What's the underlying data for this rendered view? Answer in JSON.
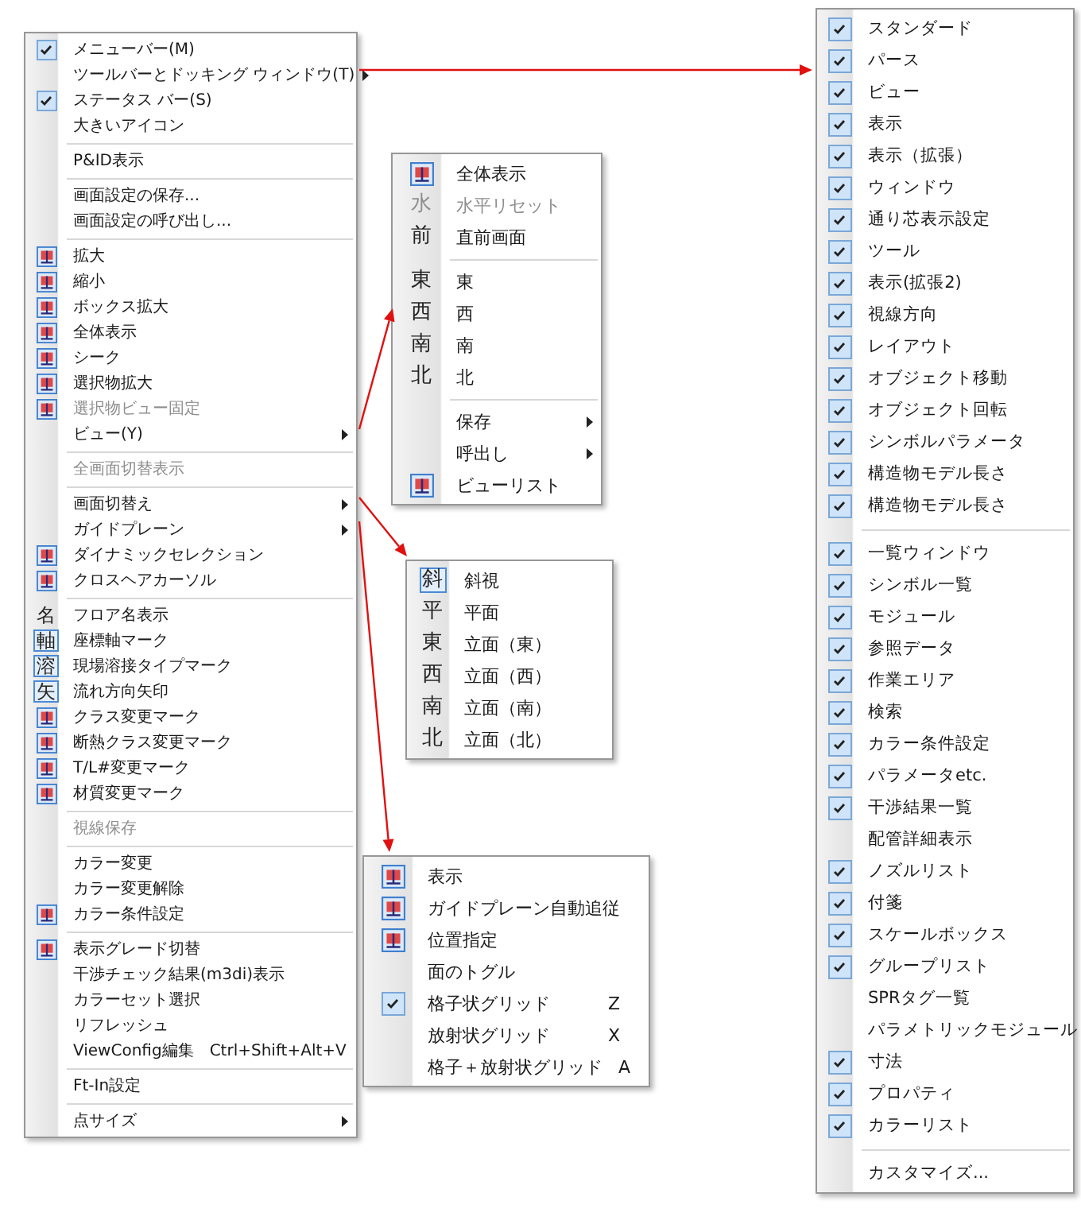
{
  "menus": [
    {
      "items": [
        {
          "kind": "item",
          "label": "メニューバー(M)",
          "checked": true,
          "disabled": false,
          "submenu": false
        },
        {
          "kind": "item",
          "label": "ツールバーとドッキング ウィンドウ(T)",
          "checked": false,
          "disabled": false,
          "submenu": true
        },
        {
          "kind": "item",
          "label": "ステータス バー(S)",
          "checked": true,
          "disabled": false,
          "submenu": false
        },
        {
          "kind": "item",
          "label": "大きいアイコン",
          "checked": false,
          "disabled": false,
          "submenu": false
        },
        {
          "kind": "separator"
        },
        {
          "kind": "item",
          "label": "P&ID表示",
          "checked": false,
          "disabled": false,
          "submenu": false
        },
        {
          "kind": "separator"
        },
        {
          "kind": "item",
          "label": "画面設定の保存...",
          "checked": false,
          "disabled": false,
          "submenu": false
        },
        {
          "kind": "item",
          "label": "画面設定の呼び出し...",
          "checked": false,
          "disabled": false,
          "submenu": false
        },
        {
          "kind": "separator"
        },
        {
          "kind": "item",
          "label": "拡大",
          "icon": true,
          "checked": false,
          "disabled": false,
          "submenu": false
        },
        {
          "kind": "item",
          "label": "縮小",
          "icon": true,
          "checked": false,
          "disabled": false,
          "submenu": false
        },
        {
          "kind": "item",
          "label": "ボックス拡大",
          "icon": true,
          "checked": false,
          "disabled": false,
          "submenu": false
        },
        {
          "kind": "item",
          "label": "全体表示",
          "icon": true,
          "checked": false,
          "disabled": false,
          "submenu": false
        },
        {
          "kind": "item",
          "label": "シーク",
          "icon": true,
          "checked": false,
          "disabled": false,
          "submenu": false
        },
        {
          "kind": "item",
          "label": "選択物拡大",
          "icon": true,
          "checked": false,
          "disabled": false,
          "submenu": false
        },
        {
          "kind": "item",
          "label": "選択物ビュー固定",
          "icon": true,
          "checked": false,
          "disabled": true,
          "submenu": false
        },
        {
          "kind": "item",
          "label": "ビュー(Y)",
          "checked": false,
          "disabled": false,
          "submenu": true
        },
        {
          "kind": "separator"
        },
        {
          "kind": "item",
          "label": "全画面切替表示",
          "checked": false,
          "disabled": true,
          "submenu": false
        },
        {
          "kind": "separator"
        },
        {
          "kind": "item",
          "label": "画面切替え",
          "checked": false,
          "disabled": false,
          "submenu": true
        },
        {
          "kind": "item",
          "label": "ガイドプレーン",
          "checked": false,
          "disabled": false,
          "submenu": true
        },
        {
          "kind": "item",
          "label": "ダイナミックセレクション",
          "icon": true,
          "checked": false,
          "disabled": false,
          "submenu": false
        },
        {
          "kind": "item",
          "label": "クロスヘアカーソル",
          "icon": true,
          "checked": false,
          "disabled": false,
          "submenu": false
        },
        {
          "kind": "separator"
        },
        {
          "kind": "item",
          "label": "フロア名表示",
          "glyph": "名",
          "framed": false,
          "checked": false,
          "disabled": false,
          "submenu": false
        },
        {
          "kind": "item",
          "label": "座標軸マーク",
          "glyph": "軸",
          "framed": true,
          "checked": false,
          "disabled": false,
          "submenu": false
        },
        {
          "kind": "item",
          "label": "現場溶接タイプマーク",
          "glyph": "溶",
          "framed": true,
          "checked": false,
          "disabled": false,
          "submenu": false
        },
        {
          "kind": "item",
          "label": "流れ方向矢印",
          "glyph": "矢",
          "framed": true,
          "checked": false,
          "disabled": false,
          "submenu": false
        },
        {
          "kind": "item",
          "label": "クラス変更マーク",
          "icon": true,
          "checked": false,
          "disabled": false,
          "submenu": false
        },
        {
          "kind": "item",
          "label": "断熱クラス変更マーク",
          "icon": true,
          "checked": false,
          "disabled": false,
          "submenu": false
        },
        {
          "kind": "item",
          "label": "T/L#変更マーク",
          "icon": true,
          "checked": false,
          "disabled": false,
          "submenu": false
        },
        {
          "kind": "item",
          "label": "材質変更マーク",
          "icon": true,
          "checked": false,
          "disabled": false,
          "submenu": false
        },
        {
          "kind": "separator"
        },
        {
          "kind": "item",
          "label": "視線保存",
          "checked": false,
          "disabled": true,
          "submenu": false
        },
        {
          "kind": "separator"
        },
        {
          "kind": "item",
          "label": "カラー変更",
          "checked": false,
          "disabled": false,
          "submenu": false
        },
        {
          "kind": "item",
          "label": "カラー変更解除",
          "checked": false,
          "disabled": false,
          "submenu": false
        },
        {
          "kind": "item",
          "label": "カラー条件設定",
          "icon": true,
          "checked": false,
          "disabled": false,
          "submenu": false
        },
        {
          "kind": "separator"
        },
        {
          "kind": "item",
          "label": "表示グレード切替",
          "icon": true,
          "checked": false,
          "disabled": false,
          "submenu": false
        },
        {
          "kind": "item",
          "label": "干渉チェック結果(m3di)表示",
          "checked": false,
          "disabled": false,
          "submenu": false
        },
        {
          "kind": "item",
          "label": "カラーセット選択",
          "checked": false,
          "disabled": false,
          "submenu": false
        },
        {
          "kind": "item",
          "label": "リフレッシュ",
          "checked": false,
          "disabled": false,
          "submenu": false
        },
        {
          "kind": "item",
          "label": "ViewConfig編集",
          "shortcut": "Ctrl+Shift+Alt+V",
          "checked": false,
          "disabled": false,
          "submenu": false
        },
        {
          "kind": "separator"
        },
        {
          "kind": "item",
          "label": "Ft-In設定",
          "checked": false,
          "disabled": false,
          "submenu": false
        },
        {
          "kind": "separator"
        },
        {
          "kind": "item",
          "label": "点サイズ",
          "checked": false,
          "disabled": false,
          "submenu": true
        }
      ]
    },
    {
      "items": [
        {
          "kind": "item",
          "label": "全体表示",
          "icon": true,
          "disabled": false,
          "submenu": false
        },
        {
          "kind": "item",
          "label": "水平リセット",
          "glyph": "水",
          "disabled": true,
          "submenu": false
        },
        {
          "kind": "item",
          "label": "直前画面",
          "glyph": "前",
          "disabled": false,
          "submenu": false
        },
        {
          "kind": "separator"
        },
        {
          "kind": "item",
          "label": "東",
          "glyph": "東",
          "disabled": false,
          "submenu": false
        },
        {
          "kind": "item",
          "label": "西",
          "glyph": "西",
          "disabled": false,
          "submenu": false
        },
        {
          "kind": "item",
          "label": "南",
          "glyph": "南",
          "disabled": false,
          "submenu": false
        },
        {
          "kind": "item",
          "label": "北",
          "glyph": "北",
          "disabled": false,
          "submenu": false
        },
        {
          "kind": "separator"
        },
        {
          "kind": "item",
          "label": "保存",
          "disabled": false,
          "submenu": true
        },
        {
          "kind": "item",
          "label": "呼出し",
          "disabled": false,
          "submenu": true
        },
        {
          "kind": "item",
          "label": "ビューリスト",
          "icon": true,
          "disabled": false,
          "submenu": false
        }
      ]
    },
    {
      "items": [
        {
          "kind": "item",
          "label": "斜視",
          "glyph": "斜",
          "selected": true
        },
        {
          "kind": "item",
          "label": "平面",
          "glyph": "平",
          "selected": false
        },
        {
          "kind": "item",
          "label": "立面（東）",
          "glyph": "東",
          "selected": false
        },
        {
          "kind": "item",
          "label": "立面（西）",
          "glyph": "西",
          "selected": false
        },
        {
          "kind": "item",
          "label": "立面（南）",
          "glyph": "南",
          "selected": false
        },
        {
          "kind": "item",
          "label": "立面（北）",
          "glyph": "北",
          "selected": false
        }
      ]
    },
    {
      "items": [
        {
          "kind": "item",
          "label": "表示",
          "icon": true,
          "checked": false
        },
        {
          "kind": "item",
          "label": "ガイドプレーン自動追従",
          "icon": true,
          "checked": false
        },
        {
          "kind": "item",
          "label": "位置指定",
          "icon": true,
          "checked": false
        },
        {
          "kind": "item",
          "label": "面のトグル",
          "checked": false
        },
        {
          "kind": "item",
          "label": "格子状グリッド",
          "shortcut": "Z",
          "checked": true
        },
        {
          "kind": "item",
          "label": "放射状グリッド",
          "shortcut": "X",
          "checked": false
        },
        {
          "kind": "item",
          "label": "格子＋放射状グリッド",
          "shortcut": "A",
          "checked": false
        }
      ]
    },
    {
      "items": [
        {
          "kind": "item",
          "label": "スタンダード",
          "checked": true
        },
        {
          "kind": "item",
          "label": "パース",
          "checked": true
        },
        {
          "kind": "item",
          "label": "ビュー",
          "checked": true
        },
        {
          "kind": "item",
          "label": "表示",
          "checked": true
        },
        {
          "kind": "item",
          "label": "表示（拡張）",
          "checked": true
        },
        {
          "kind": "item",
          "label": "ウィンドウ",
          "checked": true
        },
        {
          "kind": "item",
          "label": "通り芯表示設定",
          "checked": true
        },
        {
          "kind": "item",
          "label": "ツール",
          "checked": true
        },
        {
          "kind": "item",
          "label": "表示(拡張2)",
          "checked": true
        },
        {
          "kind": "item",
          "label": "視線方向",
          "checked": true
        },
        {
          "kind": "item",
          "label": "レイアウト",
          "checked": true
        },
        {
          "kind": "item",
          "label": "オブジェクト移動",
          "checked": true
        },
        {
          "kind": "item",
          "label": "オブジェクト回転",
          "checked": true
        },
        {
          "kind": "item",
          "label": "シンボルパラメータ",
          "checked": true
        },
        {
          "kind": "item",
          "label": "構造物モデル長さ",
          "checked": true
        },
        {
          "kind": "item",
          "label": "構造物モデル長さ",
          "checked": true
        },
        {
          "kind": "separator"
        },
        {
          "kind": "item",
          "label": "一覧ウィンドウ",
          "checked": true
        },
        {
          "kind": "item",
          "label": "シンボル一覧",
          "checked": true
        },
        {
          "kind": "item",
          "label": "モジュール",
          "checked": true
        },
        {
          "kind": "item",
          "label": "参照データ",
          "checked": true
        },
        {
          "kind": "item",
          "label": "作業エリア",
          "checked": true
        },
        {
          "kind": "item",
          "label": "検索",
          "checked": true
        },
        {
          "kind": "item",
          "label": "カラー条件設定",
          "checked": true
        },
        {
          "kind": "item",
          "label": "パラメータetc.",
          "checked": true
        },
        {
          "kind": "item",
          "label": "干渉結果一覧",
          "checked": true
        },
        {
          "kind": "item",
          "label": "配管詳細表示",
          "checked": false
        },
        {
          "kind": "item",
          "label": "ノズルリスト",
          "checked": true
        },
        {
          "kind": "item",
          "label": "付箋",
          "checked": true
        },
        {
          "kind": "item",
          "label": "スケールボックス",
          "checked": true
        },
        {
          "kind": "item",
          "label": "グループリスト",
          "checked": true
        },
        {
          "kind": "item",
          "label": "SPRタグ一覧",
          "checked": false
        },
        {
          "kind": "item",
          "label": "パラメトリックモジュール",
          "checked": false
        },
        {
          "kind": "item",
          "label": "寸法",
          "checked": true
        },
        {
          "kind": "item",
          "label": "プロパティ",
          "checked": true
        },
        {
          "kind": "item",
          "label": "カラーリスト",
          "checked": true
        },
        {
          "kind": "separator"
        },
        {
          "kind": "item",
          "label": "カスタマイズ...",
          "checked": false
        }
      ]
    }
  ]
}
